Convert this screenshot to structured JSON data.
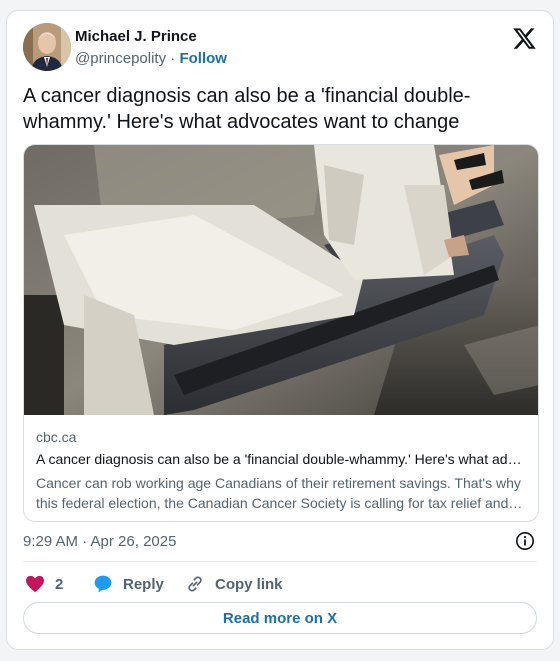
{
  "author": {
    "name": "Michael J. Prince",
    "handle": "@princepolity",
    "separator": "·",
    "follow_label": "Follow"
  },
  "tweet": {
    "text": "A cancer diagnosis can also be a 'financial double-whammy.' Here's what advocates want to change",
    "timestamp": "9:29 AM · Apr 26, 2025"
  },
  "link_card": {
    "domain": "cbc.ca",
    "title": "A cancer diagnosis can also be a 'financial double-whammy.' Here's what advocates want to change",
    "description": "Cancer can rob working age Canadians of their retirement savings. That's why this federal election, the Canadian Cancer Society is calling for tax relief and other changes."
  },
  "actions": {
    "like_count": "2",
    "reply_label": "Reply",
    "copy_link_label": "Copy link"
  },
  "read_more_label": "Read more on X",
  "colors": {
    "accent": "#1d6fa8",
    "like": "#f91880",
    "reply": "#1d9bf0",
    "muted": "#536471"
  }
}
